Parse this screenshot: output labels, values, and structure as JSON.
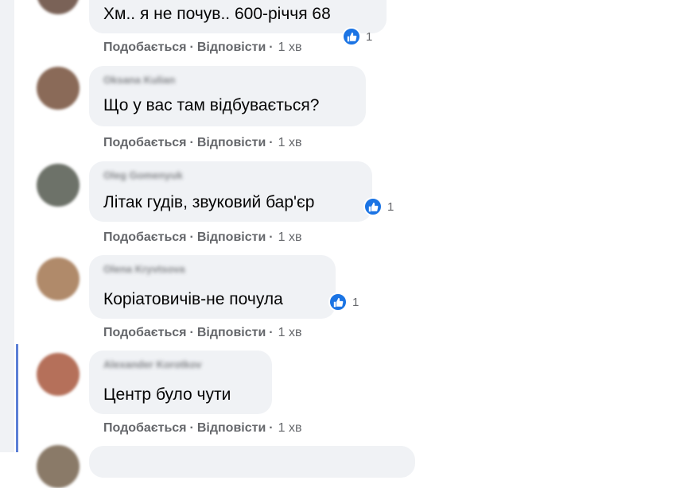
{
  "actions": {
    "like": "Подобається",
    "reply": "Відповісти",
    "separator": "·"
  },
  "comments": [
    {
      "author": "",
      "text": "Хм.. я не почув.. 600-річчя 68",
      "reactions": "1",
      "time": "1 хв",
      "avatar_color": "#7a6257"
    },
    {
      "author": "Oksana Kulian",
      "text": "Що у вас там відбувається?",
      "reactions": "",
      "time": "1 хв",
      "avatar_color": "#8a6a58"
    },
    {
      "author": "Oleg Gomenyuk",
      "text": "Літак гудів, звуковий бар'єр",
      "reactions": "1",
      "time": "1 хв",
      "avatar_color": "#6d7269"
    },
    {
      "author": "Olena Kryvtsova",
      "text": "Коріатовичів-не почула",
      "reactions": "1",
      "time": "1 хв",
      "avatar_color": "#b08a6a"
    },
    {
      "author": "Alexander Korotkov",
      "text": "Центр було чути",
      "reactions": "",
      "time": "1 хв",
      "avatar_color": "#b5705a"
    }
  ],
  "colors": {
    "like_blue": "#1b74e4",
    "bubble_bg": "#f0f2f5",
    "meta_gray": "#65676b",
    "thread_line": "#5b7fd6"
  }
}
